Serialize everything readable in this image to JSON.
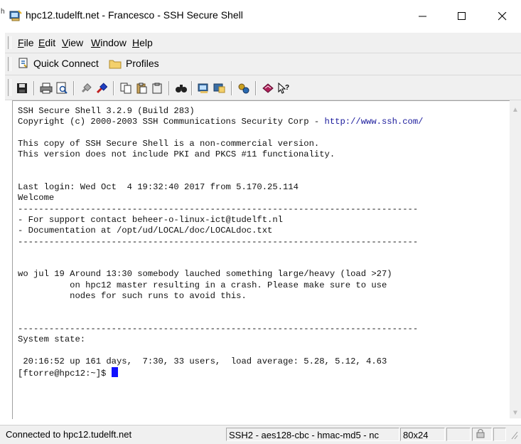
{
  "window": {
    "title": "hpc12.tudelft.net - Francesco - SSH Secure Shell",
    "edge_char": "h"
  },
  "menu": {
    "file": "File",
    "edit": "Edit",
    "view": "View",
    "window": "Window",
    "help": "Help"
  },
  "quickbar": {
    "quick_connect": "Quick Connect",
    "profiles": "Profiles"
  },
  "terminal": {
    "lines": [
      "SSH Secure Shell 3.2.9 (Build 283)",
      "Copyright (c) 2000-2003 SSH Communications Security Corp - ",
      "",
      "This copy of SSH Secure Shell is a non-commercial version.",
      "This version does not include PKI and PKCS #11 functionality.",
      "",
      "",
      "Last login: Wed Oct  4 19:32:40 2017 from 5.170.25.114",
      "Welcome",
      "-----------------------------------------------------------------------------",
      "- For support contact beheer-o-linux-ict@tudelft.nl",
      "- Documentation at /opt/ud/LOCAL/doc/LOCALdoc.txt",
      "-----------------------------------------------------------------------------",
      "",
      "",
      "wo jul 19 Around 13:30 somebody lauched something large/heavy (load >27)",
      "          on hpc12 master resulting in a crash. Please make sure to use",
      "          nodes for such runs to avoid this.",
      "",
      "",
      "-----------------------------------------------------------------------------",
      "System state:",
      "",
      " 20:16:52 up 161 days,  7:30, 33 users,  load average: 5.28, 5.12, 4.63",
      "[ftorre@hpc12:~]$ "
    ],
    "link": "http://www.ssh.com/"
  },
  "status": {
    "connection": "Connected to hpc12.tudelft.net",
    "cipher": "SSH2 - aes128-cbc - hmac-md5 - nc",
    "size": "80x24"
  },
  "colors": {
    "cursor": "#1010ff",
    "link": "#1a1a9c"
  }
}
